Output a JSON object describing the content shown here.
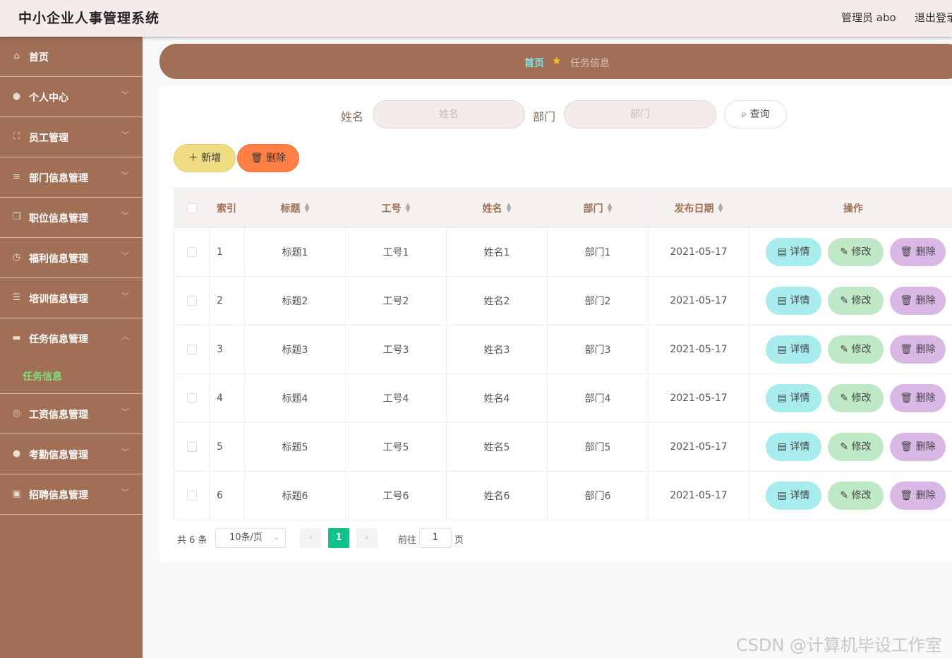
{
  "header": {
    "title": "中小企业人事管理系统",
    "user": "管理员 abo",
    "logout": "退出登录"
  },
  "sidebar": {
    "items": [
      {
        "label": "首页",
        "icon": "home-icon"
      },
      {
        "label": "个人中心",
        "icon": "user-icon"
      },
      {
        "label": "员工管理",
        "icon": "frame-icon"
      },
      {
        "label": "部门信息管理",
        "icon": "sliders-icon"
      },
      {
        "label": "职位信息管理",
        "icon": "copy-icon"
      },
      {
        "label": "福利信息管理",
        "icon": "clock-icon"
      },
      {
        "label": "培训信息管理",
        "icon": "list-icon"
      },
      {
        "label": "任务信息管理",
        "icon": "folder-icon",
        "open": true,
        "sub": "任务信息"
      },
      {
        "label": "工资信息管理",
        "icon": "compass-icon"
      },
      {
        "label": "考勤信息管理",
        "icon": "user-icon"
      },
      {
        "label": "招聘信息管理",
        "icon": "chart-icon"
      }
    ],
    "active_color": "#7ee07a"
  },
  "breadcrumb": {
    "home": "首页",
    "current": "任务信息"
  },
  "search": {
    "name_label": "姓名",
    "name_placeholder": "姓名",
    "dept_label": "部门",
    "dept_placeholder": "部门",
    "query": "查询"
  },
  "actions": {
    "add": "新增",
    "delete": "删除"
  },
  "table": {
    "headers": [
      "索引",
      "标题",
      "工号",
      "姓名",
      "部门",
      "发布日期",
      "操作"
    ],
    "rows": [
      {
        "index": "1",
        "title": "标题1",
        "job_no": "工号1",
        "name": "姓名1",
        "dept": "部门1",
        "date": "2021-05-17"
      },
      {
        "index": "2",
        "title": "标题2",
        "job_no": "工号2",
        "name": "姓名2",
        "dept": "部门2",
        "date": "2021-05-17"
      },
      {
        "index": "3",
        "title": "标题3",
        "job_no": "工号3",
        "name": "姓名3",
        "dept": "部门3",
        "date": "2021-05-17"
      },
      {
        "index": "4",
        "title": "标题4",
        "job_no": "工号4",
        "name": "姓名4",
        "dept": "部门4",
        "date": "2021-05-17"
      },
      {
        "index": "5",
        "title": "标题5",
        "job_no": "工号5",
        "name": "姓名5",
        "dept": "部门5",
        "date": "2021-05-17"
      },
      {
        "index": "6",
        "title": "标题6",
        "job_no": "工号6",
        "name": "姓名6",
        "dept": "部门6",
        "date": "2021-05-17"
      }
    ],
    "row_actions": {
      "detail": "详情",
      "edit": "修改",
      "delete": "删除"
    }
  },
  "pagination": {
    "total": "共 6 条",
    "page_size": "10条/页",
    "current_page": "1",
    "goto_label": "前往",
    "goto_value": "1",
    "page_suffix": "页"
  },
  "watermark": "CSDN @计算机毕设工作室"
}
